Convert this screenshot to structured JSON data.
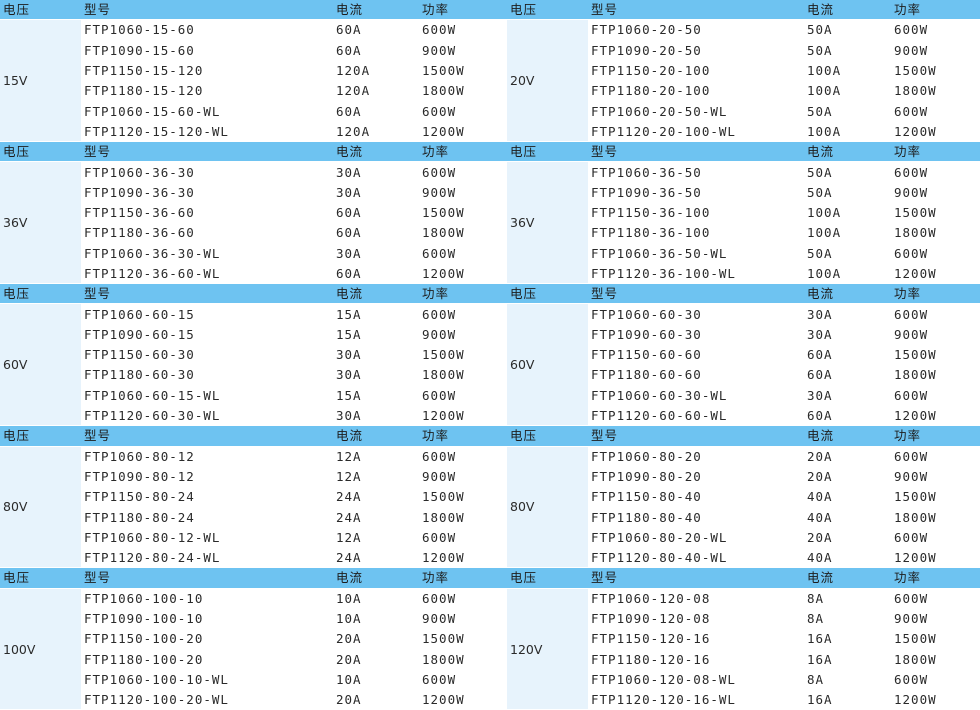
{
  "headers": {
    "voltage": "电压",
    "model": "型号",
    "current": "电流",
    "power": "功率"
  },
  "blocks": [
    {
      "left": {
        "voltage": "15V",
        "rows": [
          {
            "model": "FTP1060-15-60",
            "current": "60A",
            "power": "600W"
          },
          {
            "model": "FTP1090-15-60",
            "current": "60A",
            "power": "900W"
          },
          {
            "model": "FTP1150-15-120",
            "current": "120A",
            "power": "1500W"
          },
          {
            "model": "FTP1180-15-120",
            "current": "120A",
            "power": "1800W"
          },
          {
            "model": "FTP1060-15-60-WL",
            "current": "60A",
            "power": "600W"
          },
          {
            "model": "FTP1120-15-120-WL",
            "current": "120A",
            "power": "1200W"
          }
        ]
      },
      "right": {
        "voltage": "20V",
        "rows": [
          {
            "model": "FTP1060-20-50",
            "current": "50A",
            "power": "600W"
          },
          {
            "model": "FTP1090-20-50",
            "current": "50A",
            "power": "900W"
          },
          {
            "model": "FTP1150-20-100",
            "current": "100A",
            "power": "1500W"
          },
          {
            "model": "FTP1180-20-100",
            "current": "100A",
            "power": "1800W"
          },
          {
            "model": "FTP1060-20-50-WL",
            "current": "50A",
            "power": "600W"
          },
          {
            "model": "FTP1120-20-100-WL",
            "current": "100A",
            "power": "1200W"
          }
        ]
      }
    },
    {
      "left": {
        "voltage": "36V",
        "rows": [
          {
            "model": "FTP1060-36-30",
            "current": "30A",
            "power": "600W"
          },
          {
            "model": "FTP1090-36-30",
            "current": "30A",
            "power": "900W"
          },
          {
            "model": "FTP1150-36-60",
            "current": "60A",
            "power": "1500W"
          },
          {
            "model": "FTP1180-36-60",
            "current": "60A",
            "power": "1800W"
          },
          {
            "model": "FTP1060-36-30-WL",
            "current": "30A",
            "power": "600W"
          },
          {
            "model": "FTP1120-36-60-WL",
            "current": "60A",
            "power": "1200W"
          }
        ]
      },
      "right": {
        "voltage": "36V",
        "rows": [
          {
            "model": "FTP1060-36-50",
            "current": "50A",
            "power": "600W"
          },
          {
            "model": "FTP1090-36-50",
            "current": "50A",
            "power": "900W"
          },
          {
            "model": "FTP1150-36-100",
            "current": "100A",
            "power": "1500W"
          },
          {
            "model": "FTP1180-36-100",
            "current": "100A",
            "power": "1800W"
          },
          {
            "model": "FTP1060-36-50-WL",
            "current": "50A",
            "power": "600W"
          },
          {
            "model": "FTP1120-36-100-WL",
            "current": "100A",
            "power": "1200W"
          }
        ]
      }
    },
    {
      "left": {
        "voltage": "60V",
        "rows": [
          {
            "model": "FTP1060-60-15",
            "current": "15A",
            "power": "600W"
          },
          {
            "model": "FTP1090-60-15",
            "current": "15A",
            "power": "900W"
          },
          {
            "model": "FTP1150-60-30",
            "current": "30A",
            "power": "1500W"
          },
          {
            "model": "FTP1180-60-30",
            "current": "30A",
            "power": "1800W"
          },
          {
            "model": "FTP1060-60-15-WL",
            "current": "15A",
            "power": "600W"
          },
          {
            "model": "FTP1120-60-30-WL",
            "current": "30A",
            "power": "1200W"
          }
        ]
      },
      "right": {
        "voltage": "60V",
        "rows": [
          {
            "model": "FTP1060-60-30",
            "current": "30A",
            "power": "600W"
          },
          {
            "model": "FTP1090-60-30",
            "current": "30A",
            "power": "900W"
          },
          {
            "model": "FTP1150-60-60",
            "current": "60A",
            "power": "1500W"
          },
          {
            "model": "FTP1180-60-60",
            "current": "60A",
            "power": "1800W"
          },
          {
            "model": "FTP1060-60-30-WL",
            "current": "30A",
            "power": "600W"
          },
          {
            "model": "FTP1120-60-60-WL",
            "current": "60A",
            "power": "1200W"
          }
        ]
      }
    },
    {
      "left": {
        "voltage": "80V",
        "rows": [
          {
            "model": "FTP1060-80-12",
            "current": "12A",
            "power": "600W"
          },
          {
            "model": "FTP1090-80-12",
            "current": "12A",
            "power": "900W"
          },
          {
            "model": "FTP1150-80-24",
            "current": "24A",
            "power": "1500W"
          },
          {
            "model": "FTP1180-80-24",
            "current": "24A",
            "power": "1800W"
          },
          {
            "model": "FTP1060-80-12-WL",
            "current": "12A",
            "power": "600W"
          },
          {
            "model": "FTP1120-80-24-WL",
            "current": "24A",
            "power": "1200W"
          }
        ]
      },
      "right": {
        "voltage": "80V",
        "rows": [
          {
            "model": "FTP1060-80-20",
            "current": "20A",
            "power": "600W"
          },
          {
            "model": "FTP1090-80-20",
            "current": "20A",
            "power": "900W"
          },
          {
            "model": "FTP1150-80-40",
            "current": "40A",
            "power": "1500W"
          },
          {
            "model": "FTP1180-80-40",
            "current": "40A",
            "power": "1800W"
          },
          {
            "model": "FTP1060-80-20-WL",
            "current": "20A",
            "power": "600W"
          },
          {
            "model": "FTP1120-80-40-WL",
            "current": "40A",
            "power": "1200W"
          }
        ]
      }
    },
    {
      "left": {
        "voltage": "100V",
        "rows": [
          {
            "model": "FTP1060-100-10",
            "current": "10A",
            "power": "600W"
          },
          {
            "model": "FTP1090-100-10",
            "current": "10A",
            "power": "900W"
          },
          {
            "model": "FTP1150-100-20",
            "current": "20A",
            "power": "1500W"
          },
          {
            "model": "FTP1180-100-20",
            "current": "20A",
            "power": "1800W"
          },
          {
            "model": "FTP1060-100-10-WL",
            "current": "10A",
            "power": "600W"
          },
          {
            "model": "FTP1120-100-20-WL",
            "current": "20A",
            "power": "1200W"
          }
        ]
      },
      "right": {
        "voltage": "120V",
        "rows": [
          {
            "model": "FTP1060-120-08",
            "current": "8A",
            "power": "600W"
          },
          {
            "model": "FTP1090-120-08",
            "current": "8A",
            "power": "900W"
          },
          {
            "model": "FTP1150-120-16",
            "current": "16A",
            "power": "1500W"
          },
          {
            "model": "FTP1180-120-16",
            "current": "16A",
            "power": "1800W"
          },
          {
            "model": "FTP1060-120-08-WL",
            "current": "8A",
            "power": "600W"
          },
          {
            "model": "FTP1120-120-16-WL",
            "current": "16A",
            "power": "1200W"
          }
        ]
      }
    }
  ]
}
